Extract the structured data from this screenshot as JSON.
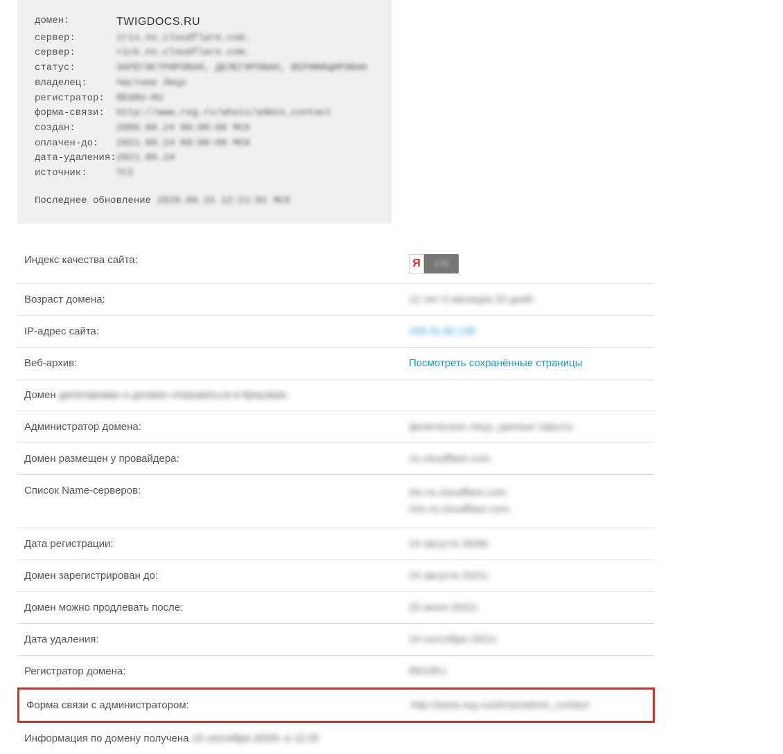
{
  "whois": {
    "labels": {
      "domain": "домен:",
      "server1": "сервер:",
      "server2": "сервер:",
      "status": "статус:",
      "owner": "владелец:",
      "registrar": "регистратор:",
      "contact_form": "форма-связи:",
      "created": "создан:",
      "paid_till": "оплачен-до:",
      "delete_date": "дата-удаления:",
      "source": "источник:"
    },
    "values": {
      "domain": "TWIGDOCS.RU",
      "server1": "iris.ns.cloudflare.com.",
      "server2": "rick.ns.cloudflare.com.",
      "status": "ЗАРЕГИСТРИРОВАН, ДЕЛЕГИРОВАН, ВЕРИФИЦИРОВАН",
      "owner": "Частное Лицо",
      "registrar": "REGRU-RU",
      "contact_form": "http://www.reg.ru/whois/admin_contact",
      "created": "2008.08.24 00:00:00 МСК",
      "paid_till": "2021.08.24 00:00:00 МСК",
      "delete_date": "2021.09.24",
      "source": "TCI"
    },
    "footer_prefix": "Последнее обновление ",
    "footer_blur": "2020.09.15 12:21:01 МСК"
  },
  "details": {
    "quality_index_label": "Индекс качества сайта:",
    "yandex_letter": "Я",
    "yandex_value": "100",
    "domain_age_label": "Возраст домена:",
    "domain_age_value": "12 лет 0 месяцев 25 дней",
    "ip_label": "IP-адрес сайта:",
    "ip_value": "104.31.82.136",
    "webarchive_label": "Веб-архив:",
    "webarchive_value": "Посмотреть сохранённые страницы",
    "domain_status_prefix": "Домен ",
    "domain_status_blur": "делегирован и должен открываться в браузере.",
    "admin_label": "Администратор домена:",
    "admin_value": "физическое лицо, данные скрыты",
    "provider_label": "Домен размещен у провайдера:",
    "provider_value": "ns.cloudflare.com",
    "nameservers_label": "Список Name-серверов:",
    "nameservers_value1": "iris.ns.cloudflare.com.",
    "nameservers_value2": "rick.ns.cloudflare.com.",
    "reg_date_label": "Дата регистрации:",
    "reg_date_value": "24 августа 2008г.",
    "reg_until_label": "Домен зарегистрирован до:",
    "reg_until_value": "24 августа 2021г.",
    "renew_after_label": "Домен можно продлевать после:",
    "renew_after_value": "25 июня 2021г.",
    "delete_date_label": "Дата удаления:",
    "delete_date_value": "24 сентября 2021г.",
    "registrar_label": "Регистратор домена:",
    "registrar_value": "REGRU",
    "contact_form_label": "Форма связи с администратором:",
    "contact_form_value": "http://www.reg.ru/whois/admin_contact",
    "info_received_prefix": "Информация по домену получена ",
    "info_received_blur": "15 сентября 2020г. в 12:25"
  }
}
